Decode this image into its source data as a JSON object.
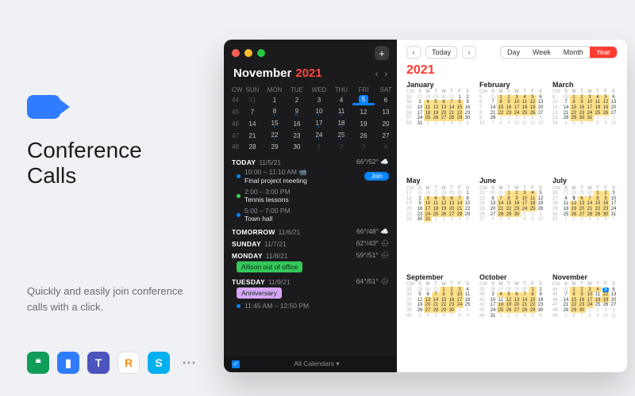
{
  "promo": {
    "title_line1": "Conference",
    "title_line2": "Calls",
    "subtitle": "Quickly and easily join conference calls with a click.",
    "brands": [
      "hangouts",
      "zoom",
      "teams",
      "ring",
      "skype"
    ]
  },
  "window": {
    "add_label": "+"
  },
  "sidebar": {
    "month": "November",
    "year": "2021",
    "dow": [
      "CW",
      "SUN",
      "MON",
      "TUE",
      "WED",
      "THU",
      "FRI",
      "SAT"
    ],
    "weeks": [
      {
        "cw": "44",
        "days": [
          {
            "n": "31",
            "dim": true
          },
          {
            "n": "1"
          },
          {
            "n": "2"
          },
          {
            "n": "3"
          },
          {
            "n": "4"
          },
          {
            "n": "5",
            "today": true,
            "dots": "•••"
          },
          {
            "n": "6"
          }
        ]
      },
      {
        "cw": "45",
        "days": [
          {
            "n": "7"
          },
          {
            "n": "8",
            "dots": "•"
          },
          {
            "n": "9",
            "dots": "••"
          },
          {
            "n": "10",
            "dots": "•"
          },
          {
            "n": "11",
            "dots": "•"
          },
          {
            "n": "12"
          },
          {
            "n": "13"
          }
        ]
      },
      {
        "cw": "46",
        "days": [
          {
            "n": "14"
          },
          {
            "n": "15",
            "dots": "•"
          },
          {
            "n": "16"
          },
          {
            "n": "17",
            "dots": "•"
          },
          {
            "n": "18",
            "dots": "•"
          },
          {
            "n": "19"
          },
          {
            "n": "20"
          }
        ]
      },
      {
        "cw": "47",
        "days": [
          {
            "n": "21"
          },
          {
            "n": "22",
            "dots": "•"
          },
          {
            "n": "23"
          },
          {
            "n": "24",
            "dots": "•"
          },
          {
            "n": "25",
            "dots": "•"
          },
          {
            "n": "26"
          },
          {
            "n": "27"
          }
        ]
      },
      {
        "cw": "48",
        "days": [
          {
            "n": "28"
          },
          {
            "n": "29"
          },
          {
            "n": "30"
          },
          {
            "n": "1",
            "dim": true
          },
          {
            "n": "2",
            "dim": true
          },
          {
            "n": "3",
            "dim": true
          },
          {
            "n": "4",
            "dim": true
          }
        ]
      }
    ],
    "footer_label": "All Calendars"
  },
  "agenda": [
    {
      "label": "TODAY",
      "date": "11/5/21",
      "weather": "66°/52°",
      "icon": "☁️",
      "events": [
        {
          "dot": "#0a84ff",
          "time": "10:00 – 11:10 AM  📹",
          "title": "Final project meeting",
          "join": "Join"
        },
        {
          "dot": "#32d74b",
          "time": "2:00 – 3:00 PM",
          "title": "Tennis lessons"
        },
        {
          "dot": "#0a84ff",
          "time": "5:00 – 7:00 PM",
          "title": "Town hall"
        }
      ]
    },
    {
      "label": "TOMORROW",
      "date": "11/6/21",
      "weather": "66°/48°",
      "icon": "☁️",
      "events": []
    },
    {
      "label": "SUNDAY",
      "date": "11/7/21",
      "weather": "62°/43°",
      "icon": "🌧",
      "events": []
    },
    {
      "label": "MONDAY",
      "date": "11/8/21",
      "weather": "59°/51°",
      "icon": "🌧",
      "events": [
        {
          "pill": "Allison out of office",
          "pillColor": "#34c759"
        }
      ]
    },
    {
      "label": "TUESDAY",
      "date": "11/9/21",
      "weather": "64°/51°",
      "icon": "🌧",
      "events": [
        {
          "pill": "Anniversary",
          "pillColor": "#d9a6ff"
        },
        {
          "dot": "#0a84ff",
          "time": "11:45 AM – 12:50 PM",
          "title": ""
        }
      ]
    }
  ],
  "toolbar": {
    "today": "Today",
    "segments": [
      "Day",
      "Week",
      "Month",
      "Year"
    ],
    "active": "Year"
  },
  "year_view": {
    "year": "2021",
    "dow": [
      "CW",
      "S",
      "M",
      "T",
      "W",
      "T",
      "F",
      "S"
    ],
    "months": [
      {
        "name": "January",
        "cw0": 53,
        "first_dow": 5,
        "ndays": 31,
        "prev_ndays": 31,
        "hl": [
          4,
          5,
          6,
          7,
          8,
          11,
          12,
          13,
          14,
          15,
          18,
          19,
          20,
          21,
          22,
          25,
          26,
          27,
          28,
          29
        ]
      },
      {
        "name": "February",
        "cw0": 5,
        "first_dow": 1,
        "ndays": 28,
        "prev_ndays": 31,
        "hl": [
          1,
          2,
          3,
          4,
          5,
          8,
          9,
          10,
          11,
          12,
          15,
          16,
          17,
          18,
          19,
          22,
          23,
          24,
          25,
          26
        ]
      },
      {
        "name": "March",
        "cw0": 9,
        "first_dow": 1,
        "ndays": 31,
        "prev_ndays": 28,
        "hl": [
          1,
          2,
          3,
          4,
          5,
          8,
          9,
          10,
          11,
          12,
          15,
          16,
          17,
          18,
          19,
          22,
          23,
          24,
          25,
          26,
          29,
          30,
          31
        ]
      },
      {
        "name": "May",
        "cw0": 17,
        "first_dow": 6,
        "ndays": 31,
        "prev_ndays": 30,
        "hl": [
          3,
          4,
          5,
          6,
          7,
          10,
          11,
          12,
          13,
          14,
          17,
          18,
          19,
          20,
          21,
          24,
          25,
          26,
          27,
          28,
          31
        ]
      },
      {
        "name": "June",
        "cw0": 22,
        "first_dow": 2,
        "ndays": 30,
        "prev_ndays": 31,
        "hl": [
          1,
          2,
          3,
          4,
          7,
          8,
          9,
          10,
          11,
          14,
          15,
          16,
          17,
          18,
          21,
          22,
          23,
          24,
          25,
          28,
          29,
          30
        ]
      },
      {
        "name": "July",
        "cw0": 26,
        "first_dow": 4,
        "ndays": 31,
        "prev_ndays": 30,
        "hl": [
          1,
          2,
          6,
          7,
          8,
          9,
          12,
          13,
          14,
          15,
          16,
          19,
          20,
          21,
          22,
          23,
          26,
          27,
          28,
          29,
          30
        ],
        "bold": [
          5
        ]
      },
      {
        "name": "September",
        "cw0": 35,
        "first_dow": 3,
        "ndays": 30,
        "prev_ndays": 31,
        "hl": [
          1,
          2,
          3,
          7,
          8,
          9,
          10,
          13,
          14,
          15,
          16,
          17,
          20,
          21,
          22,
          23,
          24,
          27,
          28,
          29,
          30
        ]
      },
      {
        "name": "October",
        "cw0": 39,
        "first_dow": 5,
        "ndays": 31,
        "prev_ndays": 30,
        "hl": [
          1,
          4,
          5,
          6,
          7,
          8,
          12,
          13,
          14,
          15,
          18,
          19,
          20,
          21,
          22,
          25,
          26,
          27,
          28,
          29
        ]
      },
      {
        "name": "November",
        "cw0": 44,
        "first_dow": 1,
        "ndays": 30,
        "prev_ndays": 31,
        "hl": [
          1,
          2,
          3,
          4,
          8,
          9,
          10,
          12,
          15,
          16,
          17,
          18,
          19,
          22,
          23,
          24,
          29,
          30
        ],
        "today": 5
      }
    ]
  }
}
